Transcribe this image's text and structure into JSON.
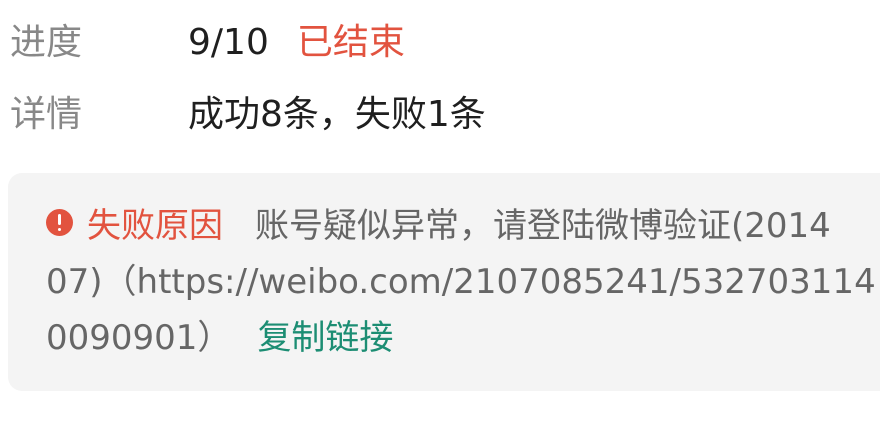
{
  "task": {
    "progress_label": "进度",
    "progress_value": "9/10",
    "status_text": "已结束",
    "detail_label": "详情",
    "detail_value": "成功8条，失败1条"
  },
  "error": {
    "icon": "alert-circle-icon",
    "title": "失败原因",
    "reason_line1": "账号疑似异常，请登陆微博验证(2014",
    "reason_line2": "07)（https://weibo.com/2107085241/532703114",
    "reason_line3": "0090901）",
    "copy_link_label": "复制链接"
  },
  "colors": {
    "accent_red": "#e2533f",
    "link_green": "#1c8d73",
    "card_bg": "#f4f4f4",
    "label_gray": "#888888"
  }
}
